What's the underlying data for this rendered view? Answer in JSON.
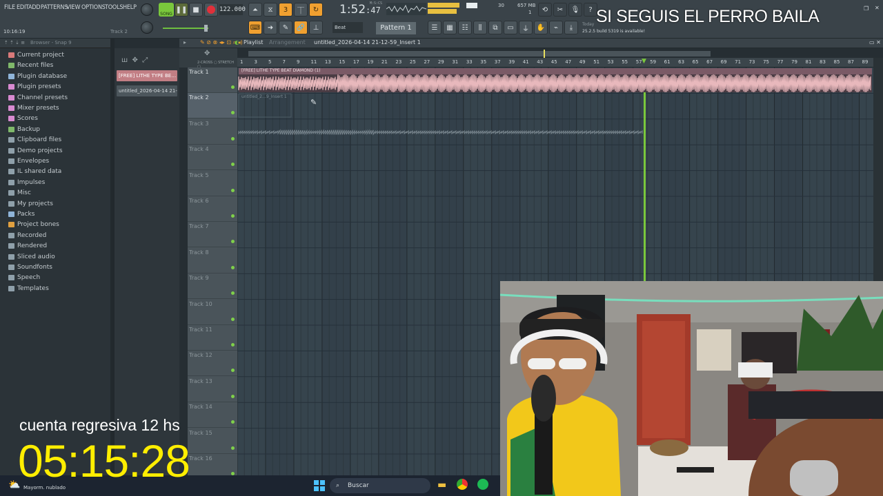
{
  "menu": [
    "FILE",
    "EDIT",
    "ADD",
    "PATTERNS",
    "VIEW",
    "OPTIONS",
    "TOOLS",
    "HELP"
  ],
  "transport": {
    "mode_label": "SONG",
    "tempo": "122.000",
    "time": "1:52",
    "time_sub": ":47",
    "time_unit": "M:S:CS",
    "cpu": "30",
    "memory": "657 MB",
    "memory_sub": "1"
  },
  "status": {
    "clock": "10:16:19",
    "focus": "Track 2",
    "news_line1": "Today",
    "news_line2": "25.2.5 build 5319 is available!"
  },
  "snap": {
    "label": "Beat"
  },
  "pattern": {
    "label": "Pattern 1"
  },
  "browser": {
    "title": "Browser - Snap 9",
    "items": [
      {
        "label": "Current project",
        "color": "#d97a7a"
      },
      {
        "label": "Recent files",
        "color": "#7fb86a"
      },
      {
        "label": "Plugin database",
        "color": "#8fb4d8"
      },
      {
        "label": "Plugin presets",
        "color": "#d88ad0"
      },
      {
        "label": "Channel presets",
        "color": "#d88ad0"
      },
      {
        "label": "Mixer presets",
        "color": "#d88ad0"
      },
      {
        "label": "Scores",
        "color": "#d88ad0"
      },
      {
        "label": "Backup",
        "color": "#7fb86a"
      },
      {
        "label": "Clipboard files",
        "color": "#8fa0aa"
      },
      {
        "label": "Demo projects",
        "color": "#8fa0aa"
      },
      {
        "label": "Envelopes",
        "color": "#8fa0aa"
      },
      {
        "label": "IL shared data",
        "color": "#8fa0aa"
      },
      {
        "label": "Impulses",
        "color": "#8fa0aa"
      },
      {
        "label": "Misc",
        "color": "#8fa0aa"
      },
      {
        "label": "My projects",
        "color": "#8fa0aa"
      },
      {
        "label": "Packs",
        "color": "#8fb4d8"
      },
      {
        "label": "Project bones",
        "color": "#e0a040"
      },
      {
        "label": "Recorded",
        "color": "#8fa0aa"
      },
      {
        "label": "Rendered",
        "color": "#8fa0aa"
      },
      {
        "label": "Sliced audio",
        "color": "#8fa0aa"
      },
      {
        "label": "Soundfonts",
        "color": "#8fa0aa"
      },
      {
        "label": "Speech",
        "color": "#8fa0aa"
      },
      {
        "label": "Templates",
        "color": "#8fa0aa"
      }
    ]
  },
  "picker": {
    "clips": [
      "[FREE] LITHE TYPE BE…",
      "untitled_2026-04-14 21-…"
    ]
  },
  "playlist": {
    "title": "Playlist",
    "subtitle": "Arrangement",
    "project": "untitled_2026-04-14 21-12-59_Insert 1",
    "ruler": [
      "1",
      "3",
      "5",
      "7",
      "9",
      "11",
      "13",
      "15",
      "17",
      "19",
      "21",
      "23",
      "25",
      "27",
      "29",
      "31",
      "33",
      "35",
      "37",
      "39",
      "41",
      "43",
      "45",
      "47",
      "49",
      "51",
      "53",
      "55",
      "57",
      "59",
      "61",
      "63",
      "65",
      "67",
      "69",
      "71",
      "73",
      "75",
      "77",
      "79",
      "81",
      "83",
      "85",
      "87",
      "89"
    ],
    "tracks": [
      "Track 1",
      "Track 2",
      "Track 3",
      "Track 4",
      "Track 5",
      "Track 6",
      "Track 7",
      "Track 8",
      "Track 9",
      "Track 10",
      "Track 11",
      "Track 12",
      "Track 13",
      "Track 14",
      "Track 15",
      "Track 16"
    ],
    "clip1_label": "[FREE] LITHE TYPE BEAT DIAMOND (1)",
    "clip2_label": "untitled_2…9_Insert 1"
  },
  "taskbar": {
    "weather": "Mayorm. nublado",
    "search": "Buscar"
  },
  "overlay": {
    "title": "SI SEGUIS EL PERRO BAILA",
    "countdown_label": "cuenta regresiva 12 hs",
    "countdown": "05:15:28"
  }
}
